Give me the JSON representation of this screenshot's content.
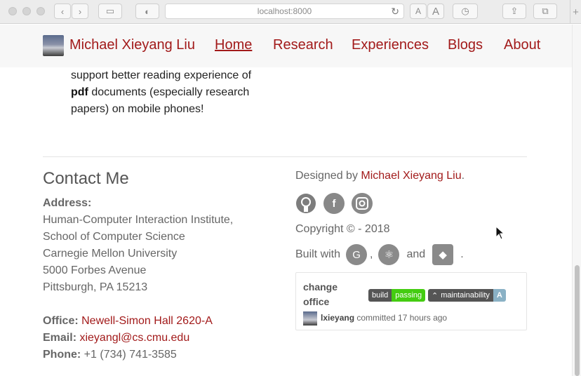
{
  "browser": {
    "url": "localhost:8000",
    "font_small": "A",
    "font_large": "A"
  },
  "nav": {
    "brand": "Michael Xieyang Liu",
    "items": [
      {
        "label": "Home",
        "active": true
      },
      {
        "label": "Research"
      },
      {
        "label": "Experiences"
      },
      {
        "label": "Blogs"
      },
      {
        "label": "About"
      }
    ]
  },
  "intro": {
    "line1": "support better reading experience of",
    "bold": "pdf",
    "line2_rest": " documents (especially research",
    "line3": "papers) on mobile phones!"
  },
  "contact": {
    "title": "Contact Me",
    "address_label": "Address:",
    "address_lines": [
      "Human-Computer Interaction Institute,",
      "School of Computer Science",
      "Carnegie Mellon University",
      "5000 Forbes Avenue",
      "Pittsburgh, PA 15213"
    ],
    "office_label": "Office:",
    "office_value": "Newell-Simon Hall 2620-A",
    "email_label": "Email:",
    "email_value": "xieyangl@cs.cmu.edu",
    "phone_label": "Phone:",
    "phone_value": "+1 (734) 741-3585"
  },
  "footer": {
    "designed_prefix": "Designed by ",
    "designer": "Michael Xieyang Liu",
    "designed_suffix": ".",
    "copyright": "Copyright © - 2018",
    "built_prefix": "Built with",
    "built_comma": ",",
    "built_and": "and",
    "built_end": "."
  },
  "commit_card": {
    "title": "change office",
    "badge_build_label": "build",
    "badge_build_status": "passing",
    "badge_maint_label": "maintainability",
    "badge_maint_grade": "A",
    "committer": "lxieyang",
    "action": " committed 17 hours ago"
  },
  "icons": {
    "social": [
      "github-icon",
      "facebook-icon",
      "instagram-icon"
    ],
    "built_with": [
      "gatsby-icon",
      "react-icon",
      "netlify-icon"
    ]
  }
}
